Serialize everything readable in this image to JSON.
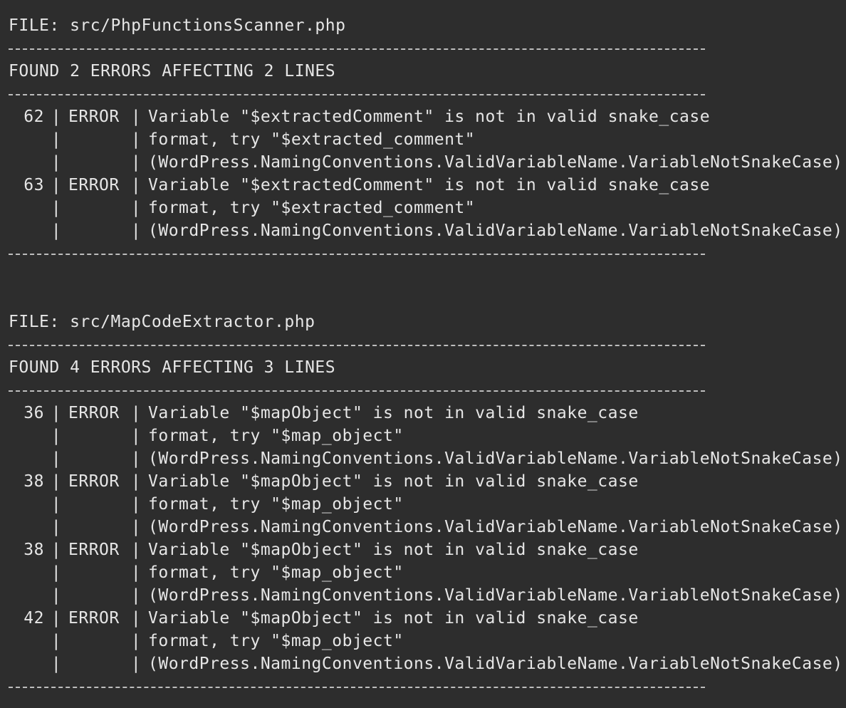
{
  "files": [
    {
      "header": "FILE: src/PhpFunctionsScanner.php",
      "summary": "FOUND 2 ERRORS AFFECTING 2 LINES",
      "errors": [
        {
          "line": "62",
          "type": "ERROR",
          "message1": "Variable \"$extractedComment\" is not in valid snake_case",
          "message2": "format, try \"$extracted_comment\"",
          "message3": "(WordPress.NamingConventions.ValidVariableName.VariableNotSnakeCase)"
        },
        {
          "line": "63",
          "type": "ERROR",
          "message1": "Variable \"$extractedComment\" is not in valid snake_case",
          "message2": "format, try \"$extracted_comment\"",
          "message3": "(WordPress.NamingConventions.ValidVariableName.VariableNotSnakeCase)"
        }
      ]
    },
    {
      "header": "FILE: src/MapCodeExtractor.php",
      "summary": "FOUND 4 ERRORS AFFECTING 3 LINES",
      "errors": [
        {
          "line": "36",
          "type": "ERROR",
          "message1": "Variable \"$mapObject\" is not in valid snake_case",
          "message2": "format, try \"$map_object\"",
          "message3": "(WordPress.NamingConventions.ValidVariableName.VariableNotSnakeCase)"
        },
        {
          "line": "38",
          "type": "ERROR",
          "message1": "Variable \"$mapObject\" is not in valid snake_case",
          "message2": "format, try \"$map_object\"",
          "message3": "(WordPress.NamingConventions.ValidVariableName.VariableNotSnakeCase)"
        },
        {
          "line": "38",
          "type": "ERROR",
          "message1": "Variable \"$mapObject\" is not in valid snake_case",
          "message2": "format, try \"$map_object\"",
          "message3": "(WordPress.NamingConventions.ValidVariableName.VariableNotSnakeCase)"
        },
        {
          "line": "42",
          "type": "ERROR",
          "message1": "Variable \"$mapObject\" is not in valid snake_case",
          "message2": "format, try \"$map_object\"",
          "message3": "(WordPress.NamingConventions.ValidVariableName.VariableNotSnakeCase)"
        }
      ]
    }
  ],
  "separator": "|"
}
